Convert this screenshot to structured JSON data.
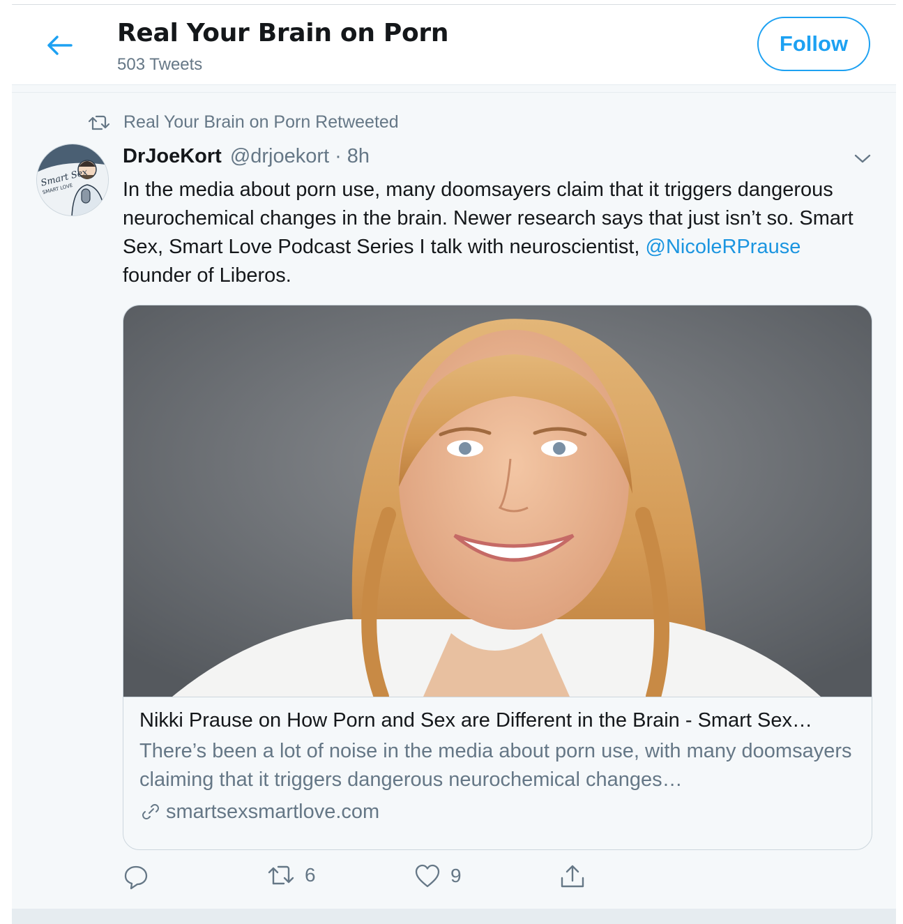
{
  "header": {
    "title": "Real Your Brain on Porn",
    "tweets_count": "503 Tweets",
    "follow_label": "Follow"
  },
  "tweet": {
    "retweeted_by": "Real Your Brain on Porn Retweeted",
    "author": {
      "display_name": "DrJoeKort",
      "handle": "@drjoekort",
      "separator": "·",
      "time": "8h",
      "avatar_text_1": "Smart Sex",
      "avatar_text_2": "SMART LOVE"
    },
    "text_part1": "In the media about porn use, many doomsayers claim that it triggers dangerous neurochemical changes in the brain. Newer research says that just isn’t so. Smart Sex, Smart Love Podcast Series I talk with neuroscientist, ",
    "mention": "@NicoleRPrause",
    "text_part2": " founder of Liberos.",
    "card": {
      "title": "Nikki Prause on How Porn and Sex are Different in the Brain - Smart Sex…",
      "description": "There’s been a lot of noise in the media about porn use, with many doomsayers claiming that it triggers dangerous neurochemical changes…",
      "domain": "smartsexsmartlove.com"
    },
    "actions": {
      "reply_count": "",
      "retweet_count": "6",
      "like_count": "9"
    }
  },
  "colors": {
    "accent": "#1da1f2",
    "mention": "#1b95e0",
    "secondary_text": "#657786",
    "tweet_bg": "#f5f8fa"
  },
  "icons": [
    "back-arrow-icon",
    "retweet-icon",
    "caret-down-icon",
    "link-icon",
    "reply-icon",
    "like-icon",
    "share-icon"
  ]
}
